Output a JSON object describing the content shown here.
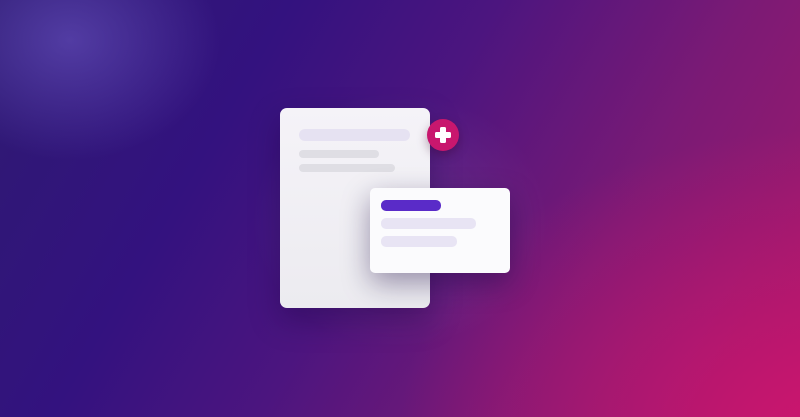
{
  "illustration": {
    "document_card": {
      "placeholder_lines": 3
    },
    "add_badge": {
      "icon": "plus-icon",
      "color": "#c8176e"
    },
    "form_card": {
      "placeholder_lines": 3,
      "accent_color": "#5a2bc8"
    }
  },
  "colors": {
    "background_start": "#2e1a72",
    "background_mid": "#4c157f",
    "background_end": "#a51a6c",
    "card": "#f5f3f8"
  }
}
